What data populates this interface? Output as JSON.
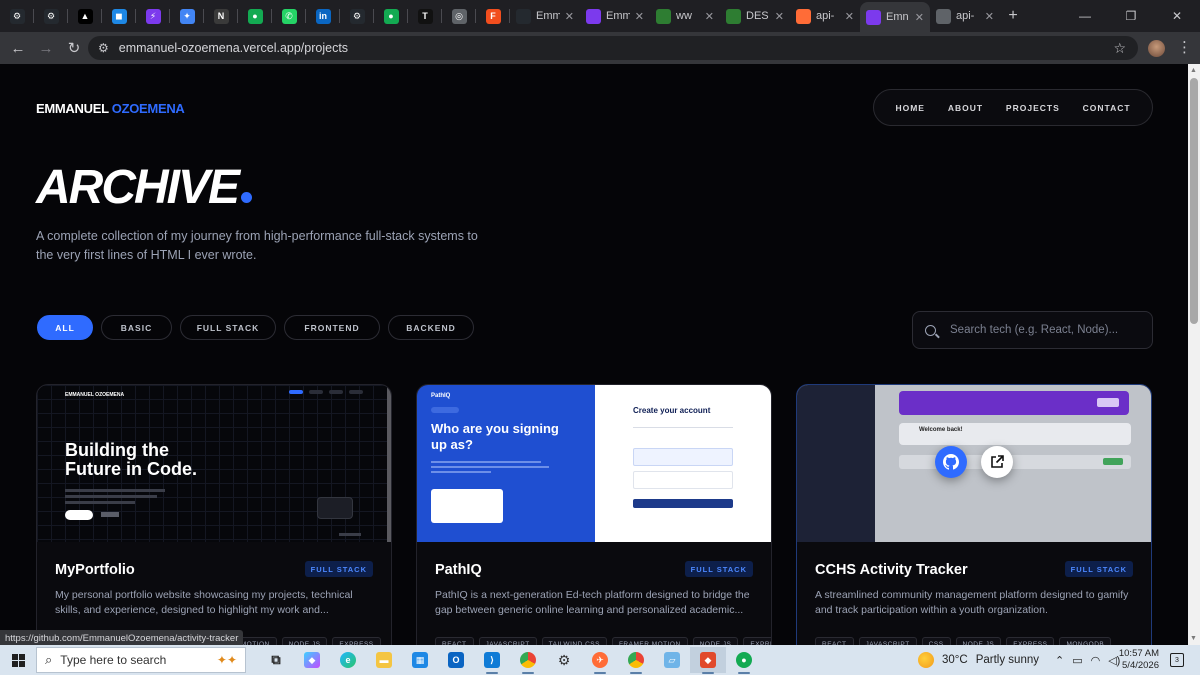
{
  "browser": {
    "tabs": [
      {
        "icon": "github-icon",
        "color": "#24292f",
        "glyph": "⚙"
      },
      {
        "icon": "github-icon",
        "color": "#24292f",
        "glyph": "⚙"
      },
      {
        "icon": "vercel-icon",
        "color": "#000000",
        "glyph": "▲"
      },
      {
        "icon": "app-icon",
        "color": "#1e88e5",
        "glyph": "◼"
      },
      {
        "icon": "bolt-icon",
        "color": "#7c3aed",
        "glyph": "⚡"
      },
      {
        "icon": "gemini-icon",
        "color": "#4285f4",
        "glyph": "✦"
      },
      {
        "icon": "notion-icon",
        "color": "#3a3a3a",
        "glyph": "N"
      },
      {
        "icon": "mongodb-icon",
        "color": "#13aa52",
        "glyph": "●"
      },
      {
        "icon": "whatsapp-icon",
        "color": "#25d366",
        "glyph": "✆"
      },
      {
        "icon": "linkedin-icon",
        "color": "#0a66c2",
        "glyph": "in"
      },
      {
        "icon": "github-icon",
        "color": "#24292f",
        "glyph": "⚙"
      },
      {
        "icon": "mongodb-icon",
        "color": "#13aa52",
        "glyph": "●"
      },
      {
        "icon": "tt-icon",
        "color": "#111111",
        "glyph": "T"
      },
      {
        "icon": "globe-icon",
        "color": "#5f6368",
        "glyph": "◎"
      },
      {
        "icon": "figma-icon",
        "color": "#f24e1e",
        "glyph": "F"
      }
    ],
    "labeled_tabs": [
      {
        "icon": "github-icon",
        "color": "#24292f",
        "label": "Emm",
        "active": false
      },
      {
        "icon": "bolt-icon",
        "color": "#7c3aed",
        "label": "Emm",
        "active": false
      },
      {
        "icon": "django-icon",
        "color": "#2e7d32",
        "label": "ww",
        "active": false
      },
      {
        "icon": "django-icon",
        "color": "#2e7d32",
        "label": "DES",
        "active": false
      },
      {
        "icon": "api-icon",
        "color": "#ff6c37",
        "label": "api-",
        "active": false
      },
      {
        "icon": "bolt-icon",
        "color": "#7c3aed",
        "label": "Emn",
        "active": true
      },
      {
        "icon": "globe-icon",
        "color": "#5f6368",
        "label": "api-",
        "active": false
      }
    ],
    "new_tab": "+",
    "url": "emmanuel-ozoemena.vercel.app/projects",
    "status_url": "https://github.com/EmmanuelOzoemena/activity-tracker"
  },
  "site": {
    "brand_first": "EMMANUEL",
    "brand_last": "OZOEMENA",
    "nav": [
      "HOME",
      "ABOUT",
      "PROJECTS",
      "CONTACT"
    ],
    "hero_title": "ARCHIVE",
    "hero_subtitle": "A complete collection of my journey from high-performance full-stack systems to the very first lines of HTML I ever wrote.",
    "filters": [
      {
        "label": "ALL",
        "active": true
      },
      {
        "label": "BASIC",
        "active": false
      },
      {
        "label": "FULL STACK",
        "active": false
      },
      {
        "label": "FRONTEND",
        "active": false
      },
      {
        "label": "BACKEND",
        "active": false
      }
    ],
    "search_placeholder": "Search tech (e.g. React, Node)...",
    "accent": "#2f6bff"
  },
  "projects": [
    {
      "title": "MyPortfolio",
      "badge": "FULL STACK",
      "description": "My personal portfolio website showcasing my projects, technical skills, and experience, designed to highlight my work and...",
      "preview_heading": "Building the Future in Code.",
      "preview_brand": "EMMANUEL OZOEMENA",
      "tags": [
        "FRAMER MOTION",
        "NODE.JS",
        "EXPRESS"
      ]
    },
    {
      "title": "PathIQ",
      "badge": "FULL STACK",
      "description": "PathIQ is a next-generation Ed-tech platform designed to bridge the gap between generic online learning and personalized academic...",
      "preview_heading": "Who are you signing up as?",
      "preview_brand": "PathIQ",
      "preview_form_title": "Create your account",
      "tags": [
        "REACT",
        "JAVASCRIPT",
        "TAILWIND CSS",
        "FRAMER MOTION",
        "NODE.JS",
        "EXPRESS"
      ]
    },
    {
      "title": "CCHS Activity Tracker",
      "badge": "FULL STACK",
      "description": "A streamlined community management platform designed to gamify and track participation within a youth organization.",
      "preview_heading": "Welcome back!",
      "tags": [
        "REACT",
        "JAVASCRIPT",
        "CSS",
        "NODE.JS",
        "EXPRESS",
        "MONGODB"
      ]
    }
  ],
  "taskbar": {
    "search_placeholder": "Type here to search",
    "weather_temp": "30°C",
    "weather_text": "Partly sunny",
    "time": "10:57 AM",
    "date": "5/4/2026",
    "notifications": "3"
  }
}
